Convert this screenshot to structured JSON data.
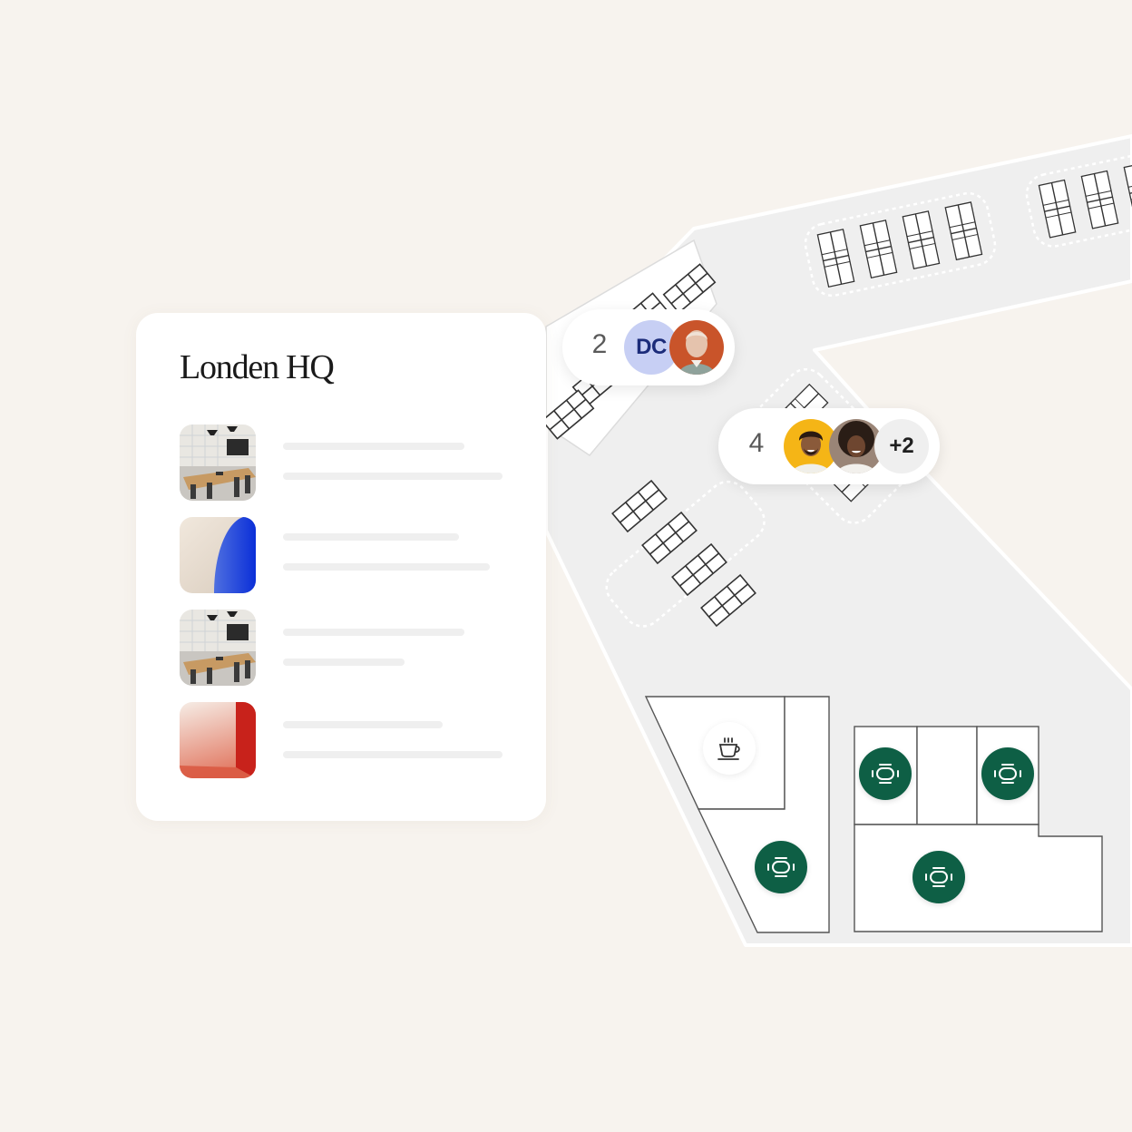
{
  "office": {
    "title": "Londen HQ",
    "rooms": [
      {
        "thumbnail": "meeting-room-photo"
      },
      {
        "thumbnail": "blue-abstract-art"
      },
      {
        "thumbnail": "meeting-room-photo"
      },
      {
        "thumbnail": "red-abstract-art"
      }
    ]
  },
  "occupancy": [
    {
      "count": "2",
      "avatars": [
        {
          "initials": "DC"
        },
        {
          "photo": "person-photo"
        }
      ]
    },
    {
      "count": "4",
      "avatars": [
        {
          "photo": "person-photo"
        },
        {
          "photo": "person-photo"
        }
      ],
      "extra": "+2"
    }
  ],
  "map_icons": {
    "meeting_room": "meeting-table-icon",
    "cafe": "coffee-cup-icon"
  },
  "colors": {
    "background": "#f7f3ee",
    "floor": "#efefef",
    "room_green": "#0e5f45",
    "initials_avatar": "#c7cff4"
  }
}
